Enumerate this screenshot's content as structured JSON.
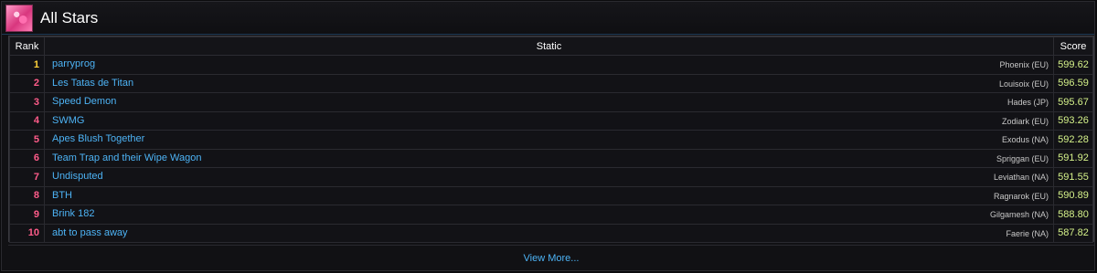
{
  "panel": {
    "title": "All Stars"
  },
  "table": {
    "headers": {
      "rank": "Rank",
      "static": "Static",
      "score": "Score"
    },
    "rows": [
      {
        "rank": "1",
        "name": "parryprog",
        "server": "Phoenix (EU)",
        "score": "599.62"
      },
      {
        "rank": "2",
        "name": "Les Tatas de Titan",
        "server": "Louisoix (EU)",
        "score": "596.59"
      },
      {
        "rank": "3",
        "name": "Speed Demon",
        "server": "Hades (JP)",
        "score": "595.67"
      },
      {
        "rank": "4",
        "name": "SWMG",
        "server": "Zodiark (EU)",
        "score": "593.26"
      },
      {
        "rank": "5",
        "name": "Apes Blush Together",
        "server": "Exodus (NA)",
        "score": "592.28"
      },
      {
        "rank": "6",
        "name": "Team Trap and their Wipe Wagon",
        "server": "Spriggan (EU)",
        "score": "591.92"
      },
      {
        "rank": "7",
        "name": "Undisputed",
        "server": "Leviathan (NA)",
        "score": "591.55"
      },
      {
        "rank": "8",
        "name": "BTH",
        "server": "Ragnarok (EU)",
        "score": "590.89"
      },
      {
        "rank": "9",
        "name": "Brink 182",
        "server": "Gilgamesh (NA)",
        "score": "588.80"
      },
      {
        "rank": "10",
        "name": "abt to pass away",
        "server": "Faerie (NA)",
        "score": "587.82"
      }
    ]
  },
  "footer": {
    "view_more": "View More..."
  },
  "colors": {
    "rank_first": "#ffd23a",
    "rank_other": "#ff5c8a",
    "link": "#4db3f5",
    "score": "#d5f28a"
  }
}
